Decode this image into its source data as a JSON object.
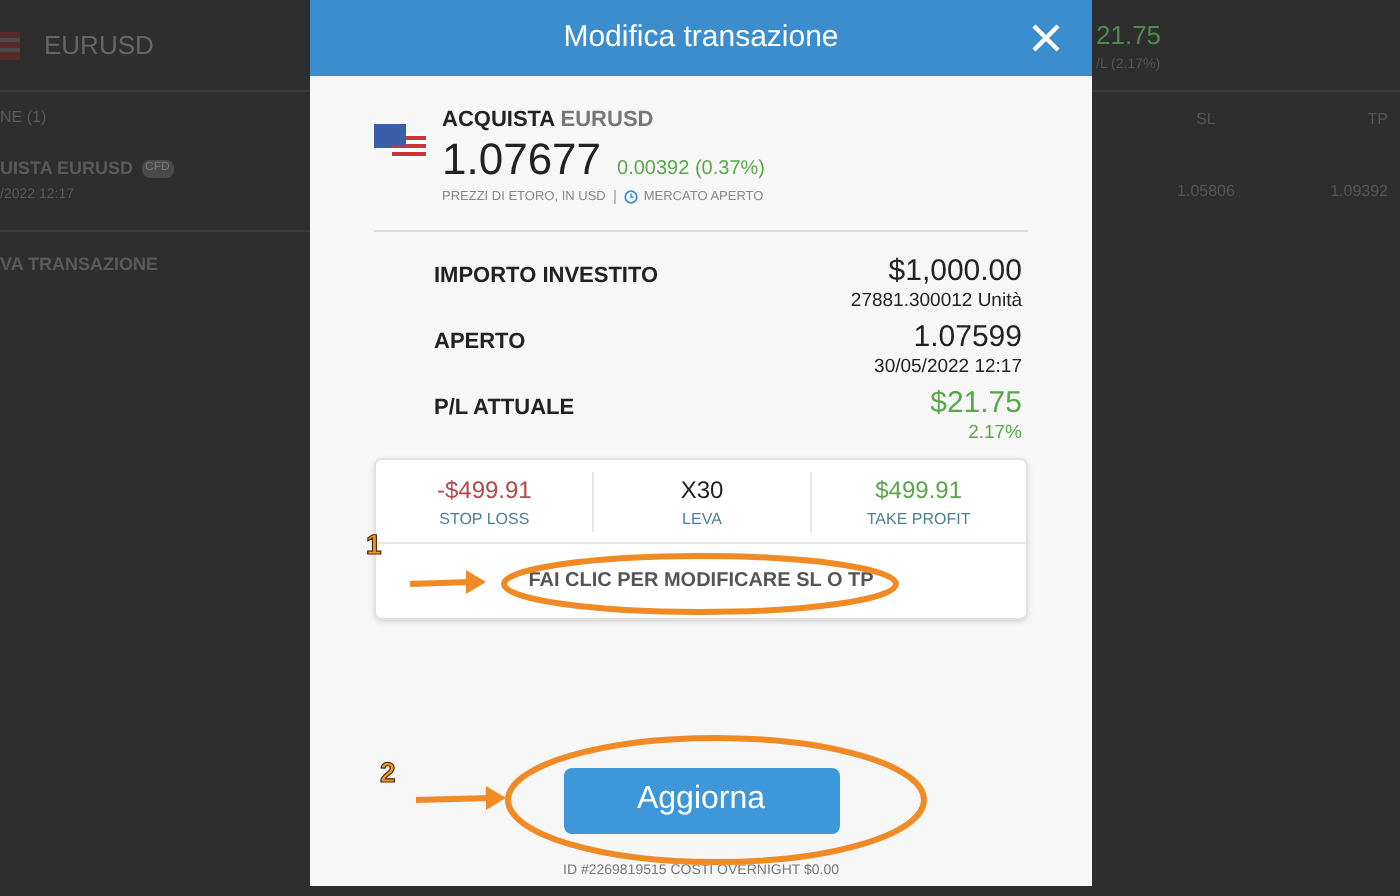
{
  "background": {
    "instrument": "EURUSD",
    "positions_header": "NE (1)",
    "position_name": "UISTA EURUSD",
    "position_badge": "CFD",
    "position_date": "/2022 12:17",
    "new_trade": "VA TRANSAZIONE",
    "pl_value": "21.75",
    "pl_label": "/L (2.17%)",
    "columns": [
      "SL",
      "TP"
    ],
    "values": [
      "1.05806",
      "1.09392"
    ]
  },
  "modal": {
    "title": "Modifica transazione",
    "action": "ACQUISTA",
    "instrument": "EURUSD",
    "price": "1.07677",
    "change": "0.00392 (0.37%)",
    "price_note": "PREZZI DI ETORO, IN USD",
    "market_status": "MERCATO APERTO",
    "rows": [
      {
        "label": "IMPORTO INVESTITO",
        "value": "$1,000.00",
        "sub": "27881.300012 Unità",
        "color": "#222222"
      },
      {
        "label": "APERTO",
        "value": "1.07599",
        "sub": "30/05/2022 12:17",
        "color": "#222222"
      },
      {
        "label": "P/L ATTUALE",
        "value": "$21.75",
        "sub": "2.17%",
        "color": "#5aa64b"
      }
    ],
    "limits": [
      {
        "value": "-$499.91",
        "label": "STOP LOSS",
        "color": "#b24a4a"
      },
      {
        "value": "X30",
        "label": "LEVA",
        "color": "#222222"
      },
      {
        "value": "$499.91",
        "label": "TAKE PROFIT",
        "color": "#5aa64b"
      }
    ],
    "edit_link": "FAI CLIC PER MODIFICARE SL O TP",
    "button": "Aggiorna",
    "footer": "ID #2269819515 COSTI OVERNIGHT $0.00"
  },
  "callouts": [
    {
      "number": "1"
    },
    {
      "number": "2"
    }
  ]
}
